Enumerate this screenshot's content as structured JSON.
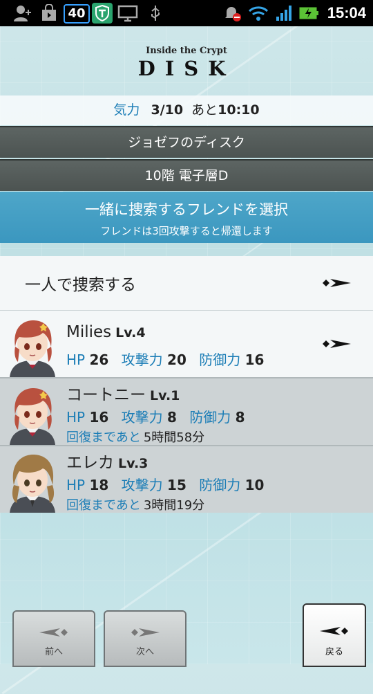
{
  "status_bar": {
    "notification_count": "40",
    "time": "15:04"
  },
  "header": {
    "subtitle": "Inside the Crypt",
    "title": "DISK"
  },
  "stamina": {
    "label": "気力",
    "value": "3/10",
    "suffix": "あと",
    "remaining": "10:10"
  },
  "disk_name": "ジョゼフのディスク",
  "floor": "10階 電子層D",
  "select_banner": {
    "line1": "一緒に捜索するフレンドを選択",
    "line2": "フレンドは3回攻撃すると帰還します"
  },
  "solo_option": {
    "label": "一人で捜索する"
  },
  "labels": {
    "hp": "HP",
    "attack": "攻撃力",
    "defense": "防御力",
    "recover_prefix": "回復まであと"
  },
  "friends": [
    {
      "name": "Milies",
      "level": "Lv.4",
      "hp": "26",
      "attack": "20",
      "defense": "16",
      "recover": ""
    },
    {
      "name": "コートニー",
      "level": "Lv.1",
      "hp": "16",
      "attack": "8",
      "defense": "8",
      "recover": "5時間58分"
    },
    {
      "name": "エレカ",
      "level": "Lv.3",
      "hp": "18",
      "attack": "15",
      "defense": "10",
      "recover": "3時間19分"
    }
  ],
  "nav": {
    "prev_label": "前へ",
    "next_label": "次へ",
    "back_label": "戻る"
  }
}
